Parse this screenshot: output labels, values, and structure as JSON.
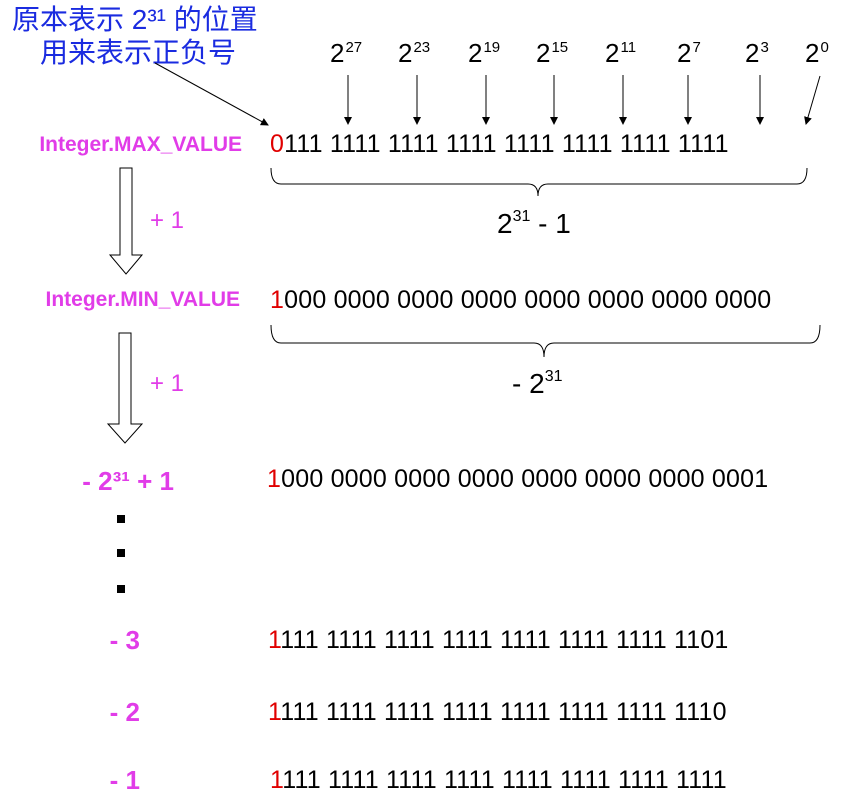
{
  "note": {
    "line1": "原本表示 2³¹ 的位置",
    "line2": "用来表示正负号"
  },
  "powers": [
    {
      "base": "2",
      "exp": "27"
    },
    {
      "base": "2",
      "exp": "23"
    },
    {
      "base": "2",
      "exp": "19"
    },
    {
      "base": "2",
      "exp": "15"
    },
    {
      "base": "2",
      "exp": "11"
    },
    {
      "base": "2",
      "exp": "7"
    },
    {
      "base": "2",
      "exp": "3"
    },
    {
      "base": "2",
      "exp": "0"
    }
  ],
  "rows": [
    {
      "label": "Integer.MAX_VALUE",
      "sign": "0",
      "rest": "111 1111 1111 1111 1111 1111 1111 1111"
    },
    {
      "label": "Integer.MIN_VALUE",
      "sign": "1",
      "rest": "000 0000 0000 0000 0000 0000 0000 0000"
    },
    {
      "label": "- 2³¹ + 1",
      "sign": "1",
      "rest": "000 0000 0000 0000 0000 0000 0000 0001"
    },
    {
      "label": "- 3",
      "sign": "1",
      "rest": "111 1111 1111 1111 1111 1111 1111 1101"
    },
    {
      "label": "- 2",
      "sign": "1",
      "rest": "111 1111 1111 1111 1111 1111 1111 1110"
    },
    {
      "label": "- 1",
      "sign": "1",
      "rest": "111 1111 1111 1111 1111 1111 1111 1111"
    }
  ],
  "steps": [
    "+ 1",
    "+ 1"
  ],
  "braces": [
    {
      "base": "2",
      "exp": "31",
      "suffix": " - 1",
      "prefix": ""
    },
    {
      "base": "2",
      "exp": "31",
      "suffix": "",
      "prefix": "- "
    }
  ],
  "colors": {
    "note": "#1a2be0",
    "label": "#e13ce8",
    "sign": "#e00000"
  }
}
